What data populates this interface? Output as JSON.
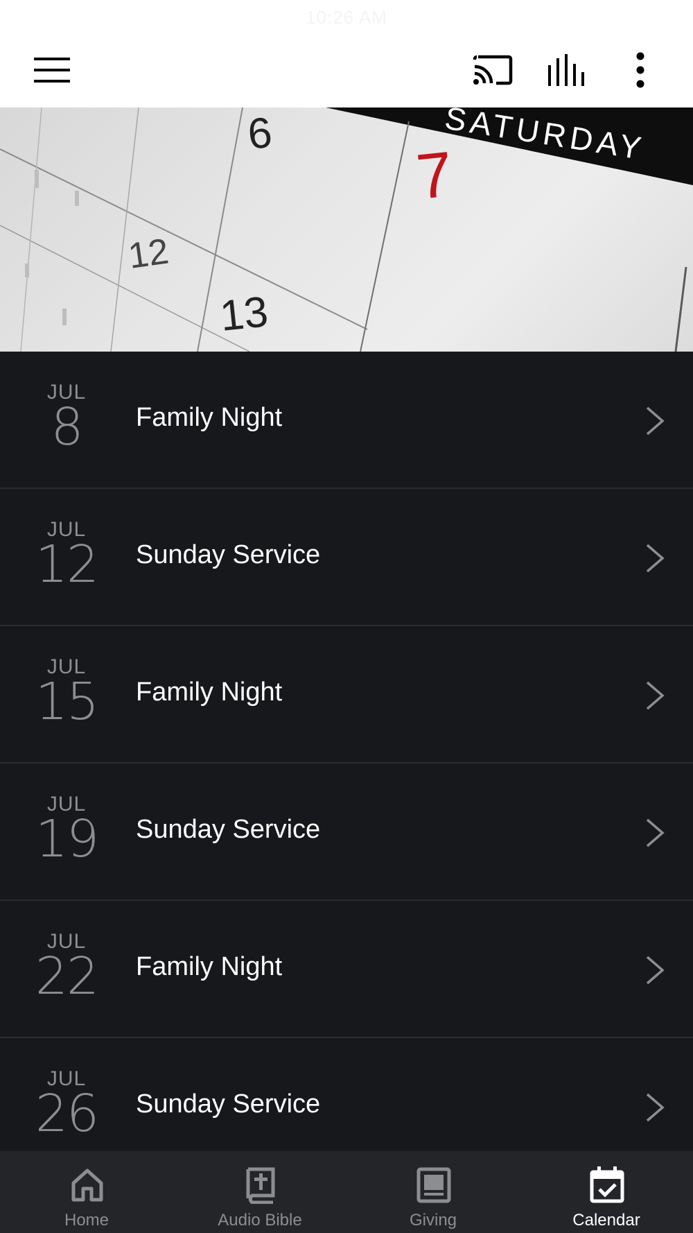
{
  "status": {
    "time": "10:26 AM"
  },
  "topbar": {
    "icons": [
      "menu-icon",
      "cast-icon",
      "equalizer-icon",
      "more-vertical-icon"
    ]
  },
  "hero": {
    "calendar_labels": {
      "day_name": "SATURDAY",
      "numbers": [
        "6",
        "7",
        "12",
        "13"
      ]
    },
    "accent_color": "#c0151b"
  },
  "events": [
    {
      "month": "JUL",
      "day": "8",
      "title": "Family Night"
    },
    {
      "month": "JUL",
      "day": "12",
      "title": "Sunday Service"
    },
    {
      "month": "JUL",
      "day": "15",
      "title": "Family Night"
    },
    {
      "month": "JUL",
      "day": "19",
      "title": "Sunday Service"
    },
    {
      "month": "JUL",
      "day": "22",
      "title": "Family Night"
    },
    {
      "month": "JUL",
      "day": "26",
      "title": "Sunday Service"
    }
  ],
  "nav": {
    "items": [
      {
        "label": "Home",
        "icon": "home-icon",
        "active": false
      },
      {
        "label": "Audio Bible",
        "icon": "bible-icon",
        "active": false
      },
      {
        "label": "Giving",
        "icon": "giving-icon",
        "active": false
      },
      {
        "label": "Calendar",
        "icon": "calendar-check-icon",
        "active": true
      }
    ]
  },
  "colors": {
    "background": "#17181b",
    "nav_bg": "#242528",
    "text": "#ffffff",
    "muted": "#8d8e92"
  }
}
